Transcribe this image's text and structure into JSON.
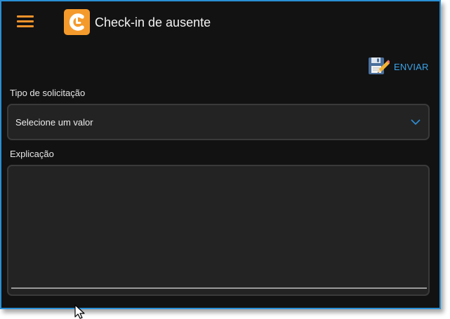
{
  "app": {
    "title": "Check-in de ausente",
    "menu_icon": "hamburger-menu-icon",
    "logo_icon": "app-logo-icon",
    "accent_color": "#f49a2c"
  },
  "toolbar": {
    "send_label": "ENVIAR",
    "send_icon": "save-edit-icon",
    "send_color": "#3aa3e8"
  },
  "form": {
    "request_type": {
      "label": "Tipo de solicitação",
      "value": "Selecione um valor",
      "icon": "chevron-down-icon"
    },
    "explanation": {
      "label": "Explicação",
      "value": ""
    }
  }
}
